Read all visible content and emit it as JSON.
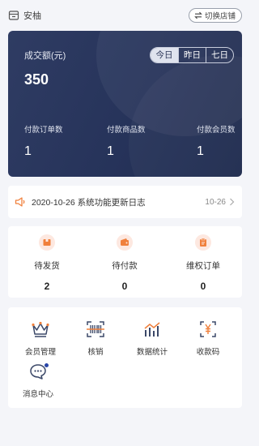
{
  "header": {
    "store_name": "安柚",
    "switch_label": "切换店铺"
  },
  "stats": {
    "label": "成交额(元)",
    "value": "350",
    "periods": [
      "今日",
      "昨日",
      "七日"
    ],
    "active_period": "今日",
    "metrics": [
      {
        "label": "付款订单数",
        "value": "1"
      },
      {
        "label": "付款商品数",
        "value": "1"
      },
      {
        "label": "付款会员数",
        "value": "1"
      }
    ]
  },
  "notice": {
    "text": "2020-10-26 系统功能更新日志",
    "date": "10-26"
  },
  "orders": [
    {
      "label": "待发货",
      "value": "2",
      "icon": "box-icon"
    },
    {
      "label": "待付款",
      "value": "0",
      "icon": "wallet-icon"
    },
    {
      "label": "维权订单",
      "value": "0",
      "icon": "clipboard-icon"
    }
  ],
  "tools": [
    {
      "label": "会员管理",
      "icon": "crown-icon"
    },
    {
      "label": "核销",
      "icon": "barcode-scan-icon"
    },
    {
      "label": "数据统计",
      "icon": "chart-icon"
    },
    {
      "label": "收款码",
      "icon": "yuan-scan-icon"
    },
    {
      "label": "消息中心",
      "icon": "message-icon"
    }
  ],
  "colors": {
    "card_bg": "#27345a",
    "accent_orange": "#f0803c",
    "badge": "#2a46a8",
    "page_bg": "#f4f5f9"
  }
}
